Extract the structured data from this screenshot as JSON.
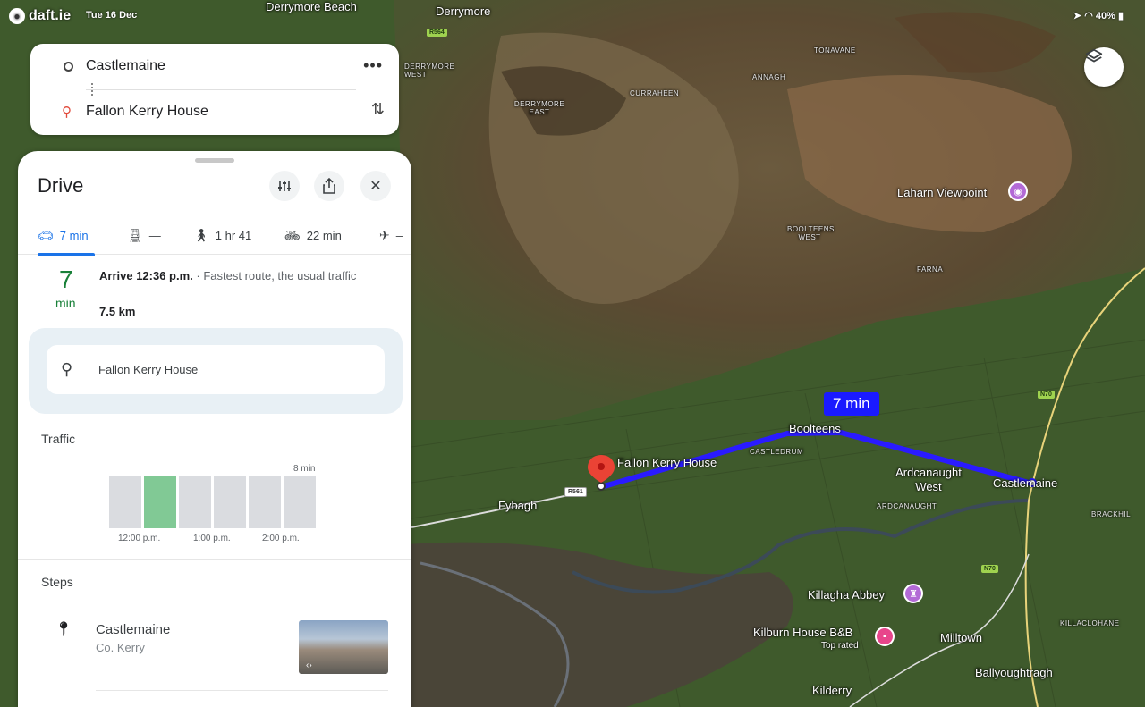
{
  "status_bar": {
    "watermark": "daft.ie",
    "date": "Tue 16 Dec",
    "right": "40%"
  },
  "search": {
    "origin": "Castlemaine",
    "destination": "Fallon Kerry House",
    "more_icon": "more-horizontal-icon",
    "swap_icon": "swap-vertical-icon"
  },
  "panel": {
    "title": "Drive",
    "tabs": [
      {
        "icon": "car-icon",
        "label": "7 min"
      },
      {
        "icon": "transit-icon",
        "label": "—"
      },
      {
        "icon": "walk-icon",
        "label": "1 hr 41"
      },
      {
        "icon": "bike-icon",
        "label": "22 min"
      },
      {
        "icon": "plane-icon",
        "label": "–"
      }
    ],
    "summary": {
      "minutes": "7",
      "unit": "min",
      "arrive": "Arrive 12:36 p.m.",
      "detail": " · Fastest route, the usual traffic",
      "distance": "7.5 km"
    },
    "destination_card": "Fallon Kerry House",
    "traffic": {
      "title": "Traffic",
      "max_label": "8 min",
      "bars": [
        0.95,
        0.95,
        0.95,
        0.95,
        0.95,
        0.95
      ],
      "highlight_index": 1,
      "ticks": [
        "12:00 p.m.",
        "1:00 p.m.",
        "2:00 p.m."
      ],
      "colors": {
        "bar": "#dadce0",
        "highlight": "#81c995"
      }
    },
    "steps": {
      "title": "Steps",
      "first": {
        "name": "Castlemaine",
        "sub": "Co. Kerry"
      }
    }
  },
  "map": {
    "route_badge": "7 min",
    "route_color": "#2a1bff",
    "labels": {
      "derrymore_beach": "Derrymore Beach",
      "derrymore": "Derrymore",
      "derrymore_west": "DERRYMORE WEST",
      "derrymore_east": "DERRYMORE EAST",
      "curraheen": "CURRAHEEN",
      "annagh": "ANNAGH",
      "tonavane": "TONAVANE",
      "laharn": "Laharn Viewpoint",
      "boolteens_west": "BOOLTEENS WEST",
      "farna": "FARNA",
      "boolteens": "Boolteens",
      "castledrum": "CASTLEDRUM",
      "fallon": "Fallon Kerry House",
      "ardcanaught_west": "Ardcanaught West",
      "ardcanaught": "ARDCANAUGHT",
      "castlemaine": "Castlemaine",
      "brackhill": "BRACKHIL",
      "fybagh": "Fybagh",
      "killagha": "Killagha Abbey",
      "kilburn": "Kilburn House B&B",
      "kilburn_sub": "Top rated",
      "milltown": "Milltown",
      "killaclohane": "KILLACLOHANE",
      "ballyoughtragh": "Ballyoughtragh",
      "kilderry": "Kilderry",
      "r561": "R561",
      "n70a": "N70",
      "n70b": "N70",
      "r564": "R564"
    }
  }
}
